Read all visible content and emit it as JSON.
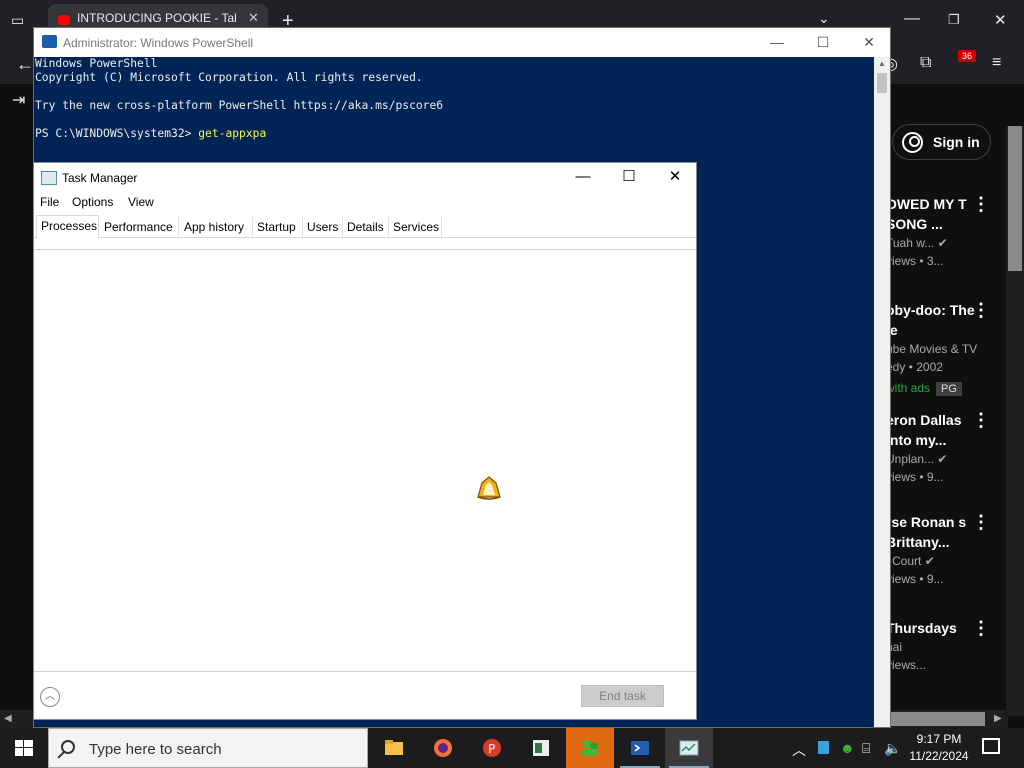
{
  "browser": {
    "tab_title": "INTRODUCING POOKIE - Talk Tu",
    "tab_close": "✕",
    "new_tab": "+",
    "ext_badge": "36",
    "sign_in": "Sign in",
    "videos": [
      {
        "title": "OWED MY T SONG ...",
        "channel": "Tuah w...",
        "meta": "views • 3..."
      },
      {
        "title": "oby-doo: The ie",
        "channel": "ube Movies & TV",
        "meta": "edy • 2002",
        "ads": "with ads",
        "rating": "PG"
      },
      {
        "title": "eron Dallas into my...",
        "channel": "Unplan...",
        "meta": "views • 9..."
      },
      {
        "title": "rse Ronan s Brittany...",
        "channel": "l Court",
        "meta": "views • 9..."
      },
      {
        "title": "Thursdays",
        "channel": "nai",
        "meta": "views..."
      }
    ]
  },
  "powershell": {
    "title": "Administrator: Windows PowerShell",
    "lines": [
      "Windows PowerShell",
      "Copyright (C) Microsoft Corporation. All rights reserved.",
      "",
      "Try the new cross-platform PowerShell https://aka.ms/pscore6",
      ""
    ],
    "prompt": "PS C:\\WINDOWS\\system32> ",
    "command": "get-appxpa"
  },
  "taskmanager": {
    "title": "Task Manager",
    "menu": [
      "File",
      "Options",
      "View"
    ],
    "tabs": [
      "Processes",
      "Performance",
      "App history",
      "Startup",
      "Users",
      "Details",
      "Services"
    ],
    "active_tab": "Processes",
    "end_task": "End task"
  },
  "taskbar": {
    "search_placeholder": "Type here to search",
    "time": "9:17 PM",
    "date": "11/22/2024"
  },
  "colors": {
    "powershell_bg": "#012456",
    "taskbar_active": "#e06a12",
    "accent_yellow": "#f5f543"
  }
}
